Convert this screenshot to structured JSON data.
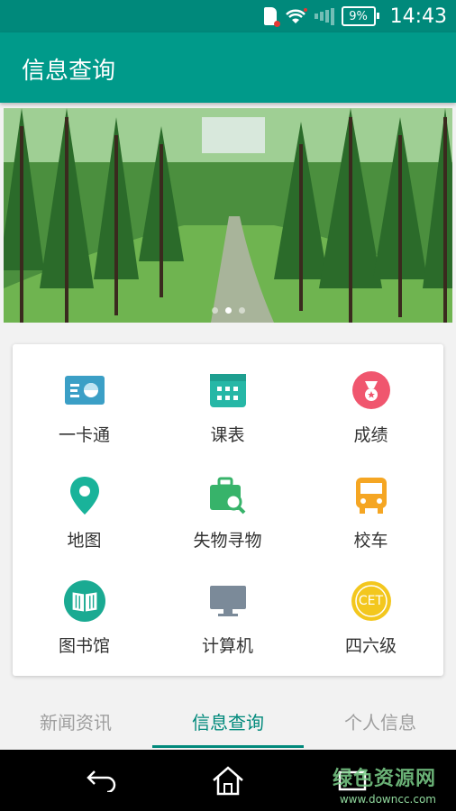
{
  "status_bar": {
    "battery": "9%",
    "time": "14:43",
    "icons": [
      "sim-icon",
      "wifi-icon",
      "signal-icon",
      "battery-icon"
    ]
  },
  "app_bar": {
    "title": "信息查询"
  },
  "banner": {
    "slide_count": 3,
    "active_slide": 2
  },
  "grid": {
    "items": [
      {
        "label": "一卡通",
        "icon": "card-icon",
        "color": "#3b9fc6"
      },
      {
        "label": "课表",
        "icon": "calendar-icon",
        "color": "#26b7a6"
      },
      {
        "label": "成绩",
        "icon": "medal-icon",
        "color": "#f0566e"
      },
      {
        "label": "地图",
        "icon": "map-pin-icon",
        "color": "#19b39a"
      },
      {
        "label": "失物寻物",
        "icon": "lost-found-icon",
        "color": "#37b36a"
      },
      {
        "label": "校车",
        "icon": "bus-icon",
        "color": "#f5a623"
      },
      {
        "label": "图书馆",
        "icon": "book-icon",
        "color": "#1aaa92"
      },
      {
        "label": "计算机",
        "icon": "monitor-icon",
        "color": "#7b8a99"
      },
      {
        "label": "四六级",
        "icon": "cet-icon",
        "color": "#f3c71e"
      }
    ],
    "cet_text": "CET"
  },
  "tabs": [
    {
      "label": "新闻资讯",
      "active": false
    },
    {
      "label": "信息查询",
      "active": true
    },
    {
      "label": "个人信息",
      "active": false
    }
  ],
  "watermark": {
    "line1": "绿色资源网",
    "line2": "www.downcc.com"
  },
  "colors": {
    "primary": "#009a8a",
    "primary_dark": "#00897b"
  }
}
